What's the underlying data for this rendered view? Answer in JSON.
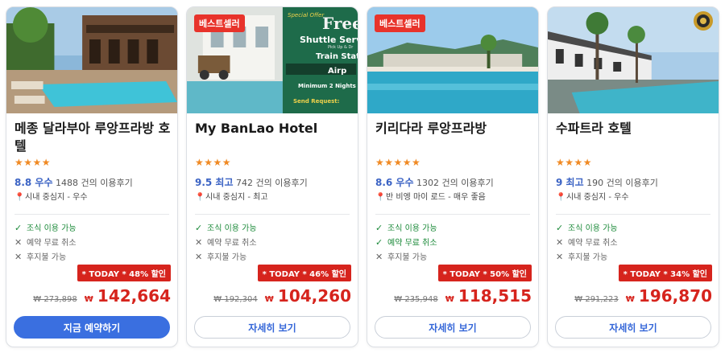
{
  "hotels": [
    {
      "name": "메종 달라부아 루앙프라방 호텔",
      "badge": "",
      "stars": "★★★★",
      "score": "8.8 우수",
      "reviews": "1488 건의 이용후기",
      "location": "시내 중심지 - 우수",
      "features": [
        "조식 이용 가능",
        "예약 무료 취소",
        "후지불 가능"
      ],
      "feature_ok": [
        true,
        false,
        false
      ],
      "discount": "* TODAY * 48% 할인",
      "orig_price": "₩ 273,898",
      "currency": "₩",
      "price": "142,664",
      "button": "지금 예약하기"
    },
    {
      "name": "My BanLao Hotel",
      "badge": "베스트셀러",
      "stars": "★★★★",
      "score": "9.5 최고",
      "reviews": "742 건의 이용후기",
      "location": "시내 중심지 - 최고",
      "features": [
        "조식 이용 가능",
        "예약 무료 취소",
        "후지불 가능"
      ],
      "feature_ok": [
        true,
        false,
        false
      ],
      "discount": "* TODAY * 46% 할인",
      "orig_price": "₩ 192,304",
      "currency": "₩",
      "price": "104,260",
      "button": "자세히 보기",
      "promo": {
        "line1": "Special Offer",
        "line2": "Free",
        "line3": "Shuttle Serv",
        "line4": "Pick Up & Dr",
        "line5": "Train Stat",
        "line6": "Airp",
        "line7": "Minimum 2 Nights",
        "line8": "Send Request:"
      }
    },
    {
      "name": "키리다라 루앙프라방",
      "badge": "베스트셀러",
      "stars": "★★★★★",
      "score": "8.6 우수",
      "reviews": "1302 건의 이용후기",
      "location": "반 비엥 마이 로드 - 매우 좋음",
      "features": [
        "조식 이용 가능",
        "예약 무료 취소",
        "후지불 가능"
      ],
      "feature_ok": [
        true,
        true,
        false
      ],
      "discount": "* TODAY * 50% 할인",
      "orig_price": "₩ 235,948",
      "currency": "₩",
      "price": "118,515",
      "button": "자세히 보기"
    },
    {
      "name": "수파트라 호텔",
      "badge": "",
      "stars": "★★★★",
      "score": "9 최고",
      "reviews": "190 건의 이용후기",
      "location": "시내 중심지 - 우수",
      "features": [
        "조식 이용 가능",
        "예약 무료 취소",
        "후지불 가능"
      ],
      "feature_ok": [
        true,
        false,
        false
      ],
      "discount": "* TODAY * 34% 할인",
      "orig_price": "₩ 291,223",
      "currency": "₩",
      "price": "196,870",
      "button": "자세히 보기"
    }
  ],
  "colors": {
    "accent_blue": "#3a6fe0",
    "score_blue": "#3b63c4",
    "sale_red": "#d6241d",
    "star_orange": "#f08a24",
    "ok_green": "#1c8a3a"
  }
}
